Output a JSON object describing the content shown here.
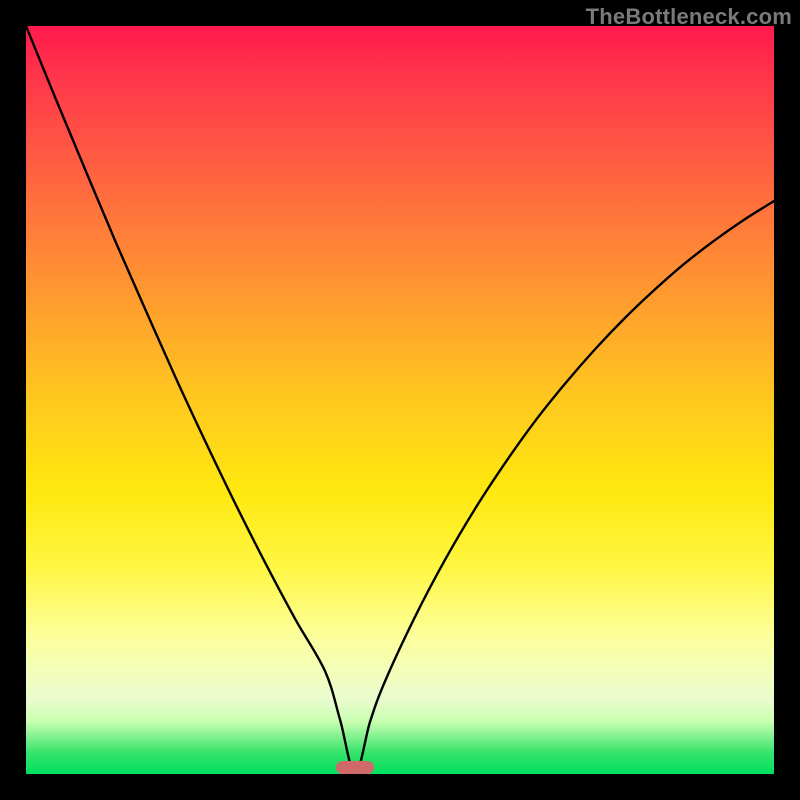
{
  "watermark": "TheBottleneck.com",
  "colors": {
    "curve": "#000000",
    "marker": "#d06a6a",
    "frame": "#000000"
  },
  "chart_data": {
    "type": "line",
    "title": "",
    "xlabel": "",
    "ylabel": "",
    "xlim": [
      0,
      100
    ],
    "ylim": [
      0,
      100
    ],
    "optimum_x": 44,
    "optimum_y": 0,
    "series": [
      {
        "name": "bottleneck-curve",
        "x": [
          0,
          4,
          8,
          12,
          16,
          20,
          24,
          28,
          32,
          36,
          40,
          42,
          44,
          46,
          48,
          52,
          56,
          60,
          64,
          68,
          72,
          76,
          80,
          84,
          88,
          92,
          96,
          100
        ],
        "y": [
          100,
          90.2,
          80.6,
          71.1,
          62.0,
          53.0,
          44.4,
          36.1,
          28.2,
          20.7,
          13.7,
          7.2,
          0.0,
          7.0,
          12.4,
          21.0,
          28.6,
          35.4,
          41.5,
          47.1,
          52.1,
          56.7,
          60.9,
          64.7,
          68.2,
          71.3,
          74.1,
          76.6
        ]
      }
    ],
    "marker": {
      "x_center": 44,
      "width_pct": 5.1,
      "height_pct": 1.7
    }
  }
}
